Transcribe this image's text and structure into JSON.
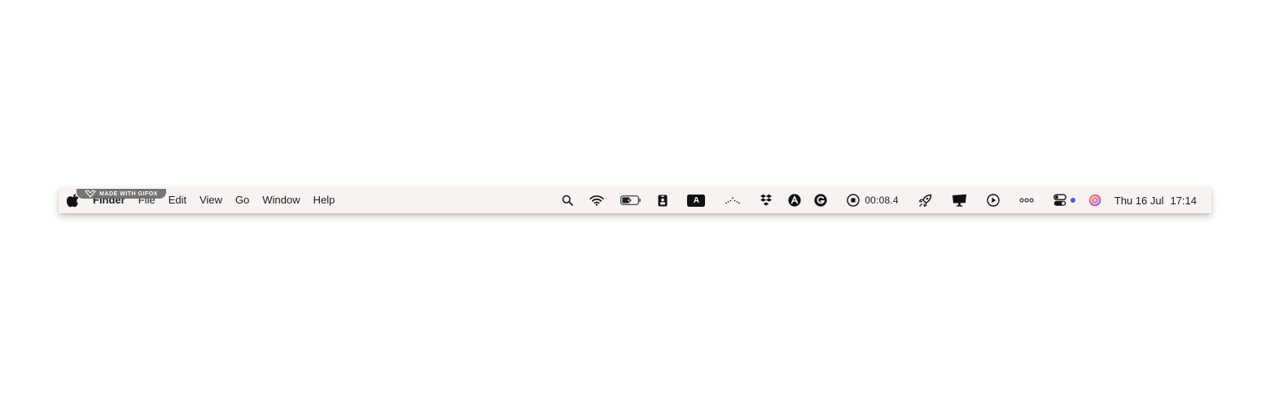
{
  "menubar": {
    "app_name": "Finder",
    "menus": [
      {
        "label": "File"
      },
      {
        "label": "Edit"
      },
      {
        "label": "View"
      },
      {
        "label": "Go"
      },
      {
        "label": "Window"
      },
      {
        "label": "Help"
      }
    ]
  },
  "watermark": {
    "text": "MADE WITH GIFOX"
  },
  "tray": {
    "icons": [
      "spotlight-search-icon",
      "wifi-icon",
      "battery-charging-icon",
      "id-badge-icon",
      "keyboard-input-a-icon",
      "dotted-wave-icon",
      "dropbox-icon",
      "a-circle-icon",
      "grammarly-icon",
      "screen-record-stop-icon",
      "rocket-icon",
      "display-icon",
      "play-circle-icon",
      "more-dots-icon",
      "control-center-icon",
      "siri-icon"
    ],
    "input_source_letter": "A",
    "record_timer": "00:08.4",
    "date": "Thu 16 Jul",
    "time": "17:14",
    "notification_dot_color": "#4b5bdc"
  },
  "colors": {
    "menubar_bg": "#f8f3f1",
    "text": "#1a1a1a",
    "watermark_bg": "#6b6b6b"
  }
}
